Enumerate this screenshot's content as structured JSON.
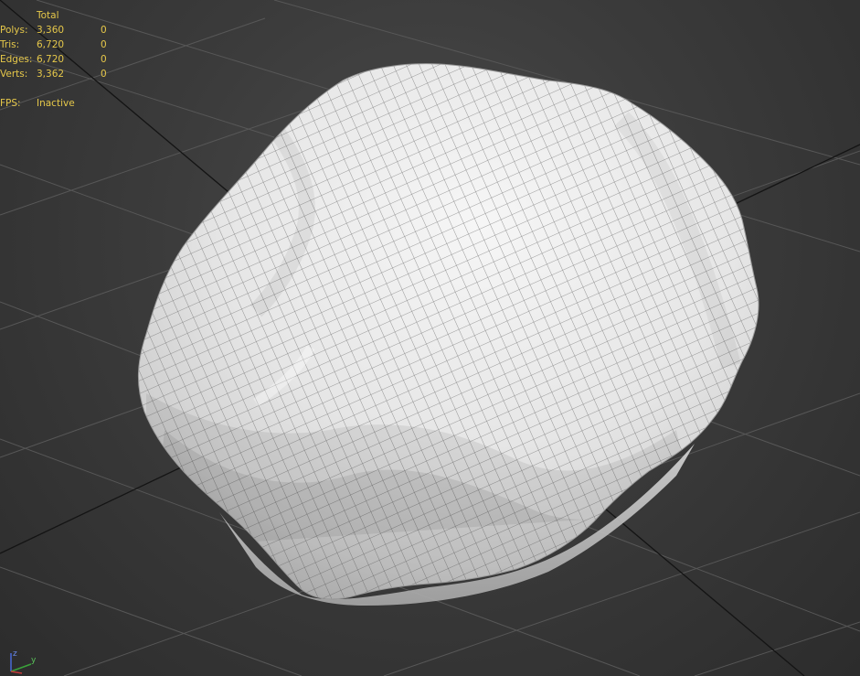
{
  "viewport": {
    "background": "#3a3a3a",
    "grid_color": "#555555",
    "axis_line_color": "#111111",
    "mesh_fill": "#ececec",
    "mesh_wire_color": "#555555",
    "stats_color": "#e6c84a"
  },
  "stats": {
    "header_total": "Total",
    "rows": [
      {
        "label": "Polys:",
        "total": "3,360",
        "selected": "0"
      },
      {
        "label": "Tris:",
        "total": "6,720",
        "selected": "0"
      },
      {
        "label": "Edges:",
        "total": "6,720",
        "selected": "0"
      },
      {
        "label": "Verts:",
        "total": "3,362",
        "selected": "0"
      }
    ],
    "fps_label": "FPS:",
    "fps_value": "Inactive"
  },
  "axis_tripod": {
    "icon": "axis-tripod-icon",
    "z_label": "z",
    "y_label": "y"
  },
  "object": {
    "icon": "rock-mesh-wireframe"
  }
}
